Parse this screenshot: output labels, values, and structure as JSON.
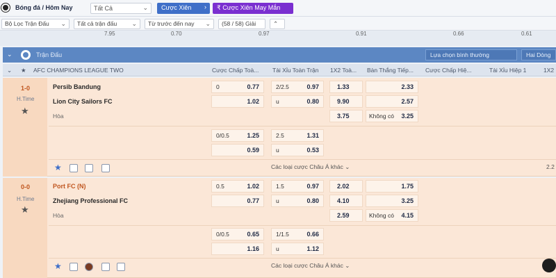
{
  "topbar": {
    "title": "Bóng đá / Hôm Nay",
    "filter": "Tất Cả",
    "parlay_button": "Cược Xiên",
    "lucky_button": "Cược Xiên May Mắn"
  },
  "filters": {
    "match_filter": "Bộ Lọc Trận Đấu",
    "all_matches": "Tất cả trận đấu",
    "sort": "Từ trước đến nay",
    "count": "(58 / 58) Giải"
  },
  "strip": {
    "cells": [
      "7.95",
      "0.70",
      "0.97",
      "0.91",
      "0.66",
      "0.61"
    ]
  },
  "section": {
    "title": "Trận Đấu",
    "select_view": "Lựa chọn bình thường",
    "select_order": "Hai Dòng"
  },
  "columns": {
    "league": "AFC CHAMPIONS LEAGUE TWO",
    "c1": "Cược Chấp Toà...",
    "c2": "Tài Xỉu Toàn Trận",
    "c3": "1X2 Toà...",
    "c4": "Bàn Thắng Tiếp...",
    "c5": "Cược Chấp Hiệ...",
    "c6": "Tài Xỉu Hiệp 1",
    "c7": "1X2"
  },
  "matches": [
    {
      "score": "1-0",
      "time": "H.Time",
      "home": "Persib Bandung",
      "away": "Lion City Sailors FC",
      "draw": "Hòa",
      "hdp1": "0",
      "hdp1_home": "0.77",
      "hdp1_away": "1.02",
      "ou1": "2/2.5",
      "ou1_over": "0.97",
      "ou1_u": "u",
      "ou1_under": "0.80",
      "x1": "1.33",
      "x2": "9.90",
      "xd": "3.75",
      "ng1": "2.33",
      "ng2": "2.57",
      "ng_label": "Không có",
      "ng3": "3.25",
      "hdp2": "0/0.5",
      "hdp2_home": "1.25",
      "hdp2_away": "0.59",
      "ou2": "2.5",
      "ou2_over": "1.31",
      "ou2_u": "u",
      "ou2_under": "0.53",
      "more": "Các loại cược Châu Á khác",
      "right_partial": "2.2"
    },
    {
      "score": "0-0",
      "time": "H.Time",
      "home": "Port FC (N)",
      "away": "Zhejiang Professional FC",
      "draw": "Hòa",
      "hdp1": "0.5",
      "hdp1_home": "1.02",
      "hdp1_away": "0.77",
      "ou1": "1.5",
      "ou1_over": "0.97",
      "ou1_u": "u",
      "ou1_under": "0.80",
      "x1": "2.02",
      "x2": "4.10",
      "xd": "2.59",
      "ng1": "1.75",
      "ng2": "3.25",
      "ng_label": "Không có",
      "ng3": "4.15",
      "hdp2": "0/0.5",
      "hdp2_home": "0.65",
      "hdp2_away": "1.16",
      "ou2": "1/1.5",
      "ou2_over": "0.66",
      "ou2_u": "u",
      "ou2_under": "1.12",
      "more": "Các loại cược Châu Á khác"
    }
  ],
  "colors": {
    "accent": "#3f6fc8",
    "lucky": "#7a2fd0",
    "section": "#5c87c3",
    "row": "#fbe7d7",
    "score": "#c0561f"
  }
}
